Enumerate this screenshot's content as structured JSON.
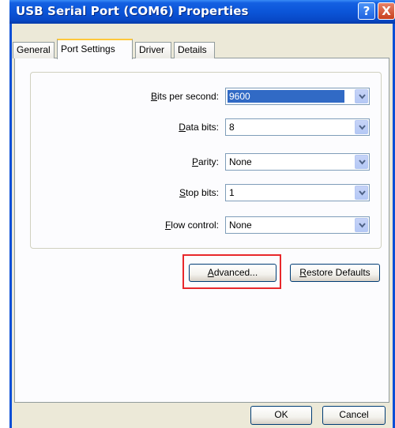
{
  "window": {
    "title": "USB Serial Port (COM6) Properties",
    "help_label": "?",
    "close_label": "X"
  },
  "tabs": [
    {
      "label": "General",
      "active": false
    },
    {
      "label": "Port Settings",
      "active": true
    },
    {
      "label": "Driver",
      "active": false
    },
    {
      "label": "Details",
      "active": false
    }
  ],
  "fields": [
    {
      "label_hotkey": "B",
      "label_rest": "its per second:",
      "value": "9600",
      "selected": true
    },
    {
      "label_hotkey": "D",
      "label_rest": "ata bits:",
      "value": "8",
      "selected": false
    },
    {
      "label_hotkey": "P",
      "label_rest": "arity:",
      "value": "None",
      "selected": false
    },
    {
      "label_hotkey": "S",
      "label_rest": "top bits:",
      "value": "1",
      "selected": false
    },
    {
      "label_hotkey": "F",
      "label_rest": "low control:",
      "value": "None",
      "selected": false
    }
  ],
  "buttons": {
    "advanced_hotkey": "A",
    "advanced_rest": "dvanced...",
    "restore_hotkey": "R",
    "restore_rest": "estore Defaults",
    "ok_label": "OK",
    "cancel_label": "Cancel"
  },
  "colors": {
    "titlebar": "#0b55d8",
    "selection": "#316ac5",
    "highlight_box": "#e8272b",
    "tab_accent": "#ffc83c"
  }
}
